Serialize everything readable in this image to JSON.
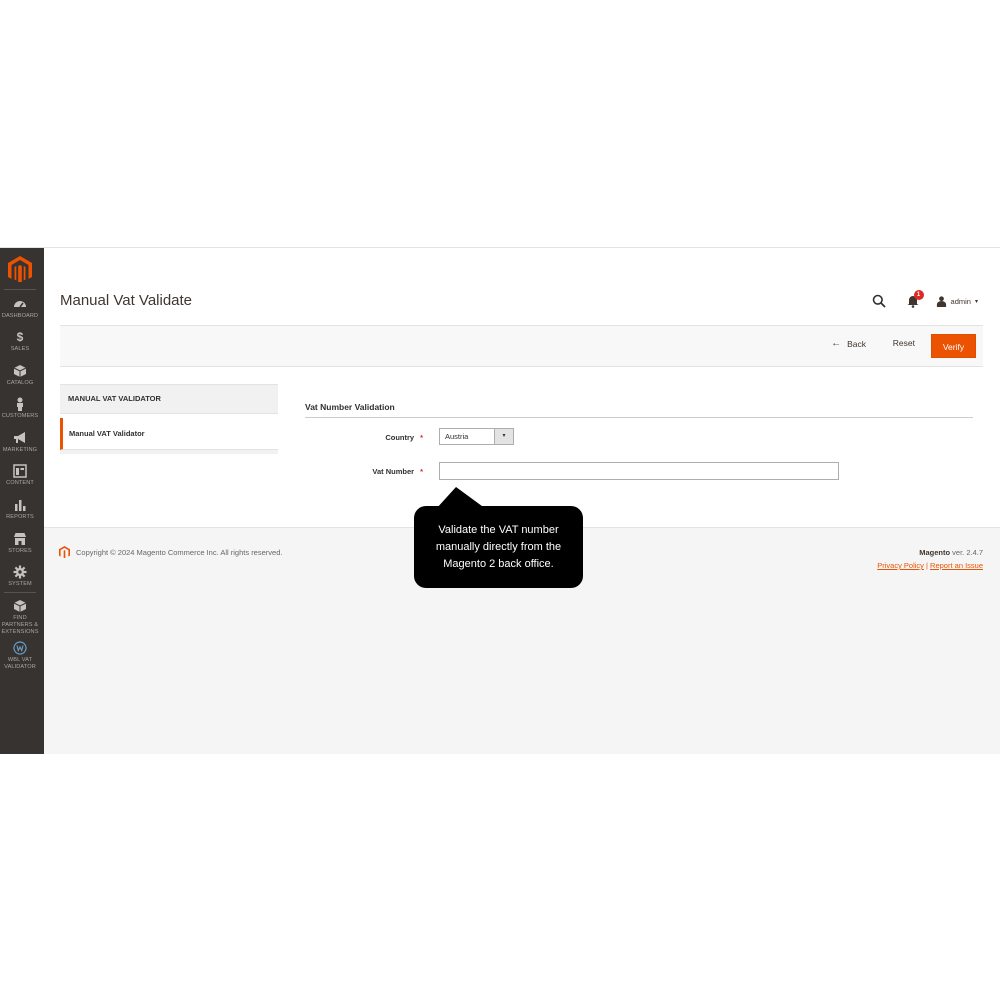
{
  "page": {
    "title": "Manual Vat Validate"
  },
  "header": {
    "notifications_count": "1",
    "user_name": "admin",
    "user_caret": "▾"
  },
  "sidebar": {
    "items": [
      {
        "label": "DASHBOARD",
        "icon": "dashboard-icon"
      },
      {
        "label": "SALES",
        "icon": "dollar-icon"
      },
      {
        "label": "CATALOG",
        "icon": "box-icon"
      },
      {
        "label": "CUSTOMERS",
        "icon": "person-icon"
      },
      {
        "label": "MARKETING",
        "icon": "megaphone-icon"
      },
      {
        "label": "CONTENT",
        "icon": "layout-icon"
      },
      {
        "label": "REPORTS",
        "icon": "bar-chart-icon"
      },
      {
        "label": "STORES",
        "icon": "store-icon"
      },
      {
        "label": "SYSTEM",
        "icon": "gear-icon"
      },
      {
        "label": "FIND PARTNERS & EXTENSIONS",
        "icon": "puzzle-box-icon"
      },
      {
        "label": "WBL VAT VALIDATOR",
        "icon": "vat-validator-icon"
      }
    ]
  },
  "actions": {
    "back_arrow": "←",
    "back_label": "Back",
    "reset_label": "Reset",
    "verify_label": "Verify"
  },
  "tabs": {
    "title": "MANUAL VAT VALIDATOR",
    "active_item": "Manual VAT Validator"
  },
  "form": {
    "fieldset_title": "Vat Number Validation",
    "country_label": "Country",
    "required_mark": "*",
    "country_value": "Austria",
    "select_caret": "▾",
    "vat_label": "Vat Number",
    "vat_value": ""
  },
  "footer": {
    "copyright": "Copyright © 2024 Magento Commerce Inc. All rights reserved.",
    "brand": "Magento",
    "version": " ver. 2.4.7",
    "privacy_link": "Privacy Policy",
    "link_separator": " | ",
    "report_link": "Report an Issue"
  },
  "callout": {
    "text": "Validate the VAT number manually directly from the Magento 2 back office."
  },
  "colors": {
    "sidebar_bg": "#373330",
    "accent": "#eb5202",
    "callout_bg": "#000000"
  }
}
